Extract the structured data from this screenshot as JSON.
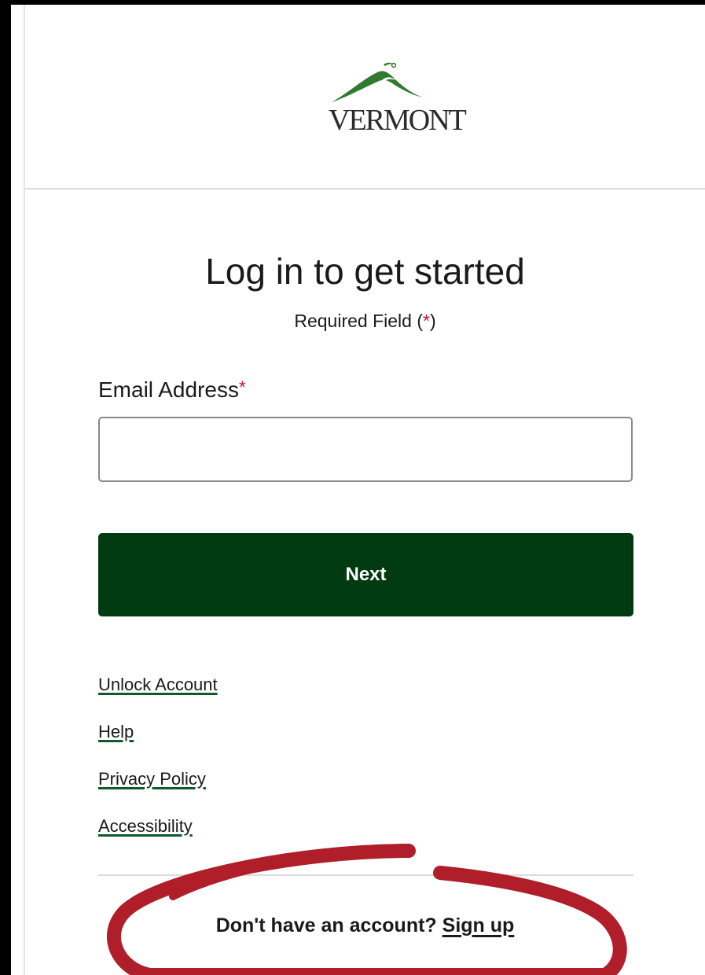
{
  "header": {
    "logo_text": "VERMONT",
    "logo_icon": "mountain-logo-icon",
    "brand_color": "#2f7a2f"
  },
  "login": {
    "title": "Log in to get started",
    "required_note_prefix": "Required Field (",
    "required_note_star": "*",
    "required_note_suffix": ")",
    "email_label": "Email Address",
    "email_required_star": "*",
    "email_value": "",
    "next_label": "Next",
    "next_color": "#003a10"
  },
  "links": [
    {
      "label": "Unlock Account"
    },
    {
      "label": "Help"
    },
    {
      "label": "Privacy Policy"
    },
    {
      "label": "Accessibility"
    }
  ],
  "signup": {
    "prompt": "Don't have an account? ",
    "link_label": "Sign up"
  },
  "annotation": {
    "color": "#b01e2a"
  }
}
